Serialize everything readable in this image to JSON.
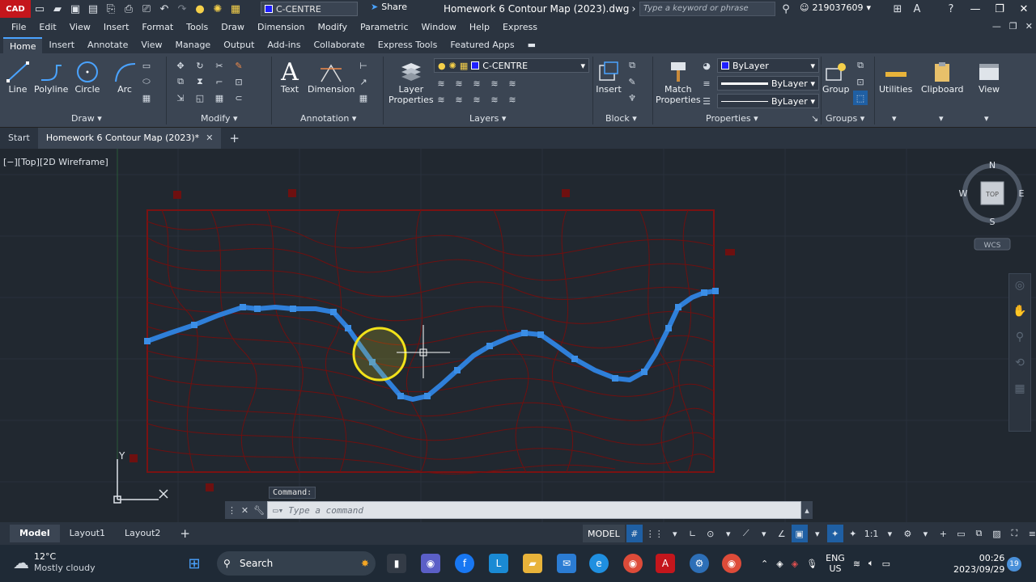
{
  "titlebar": {
    "app_badge": "CAD",
    "layer_current": "C-CENTRE",
    "share_label": "Share",
    "document_title": "Homework 6 Contour Map (2023).dwg",
    "search_placeholder": "Type a keyword or phrase",
    "user_id": "219037609"
  },
  "menu": [
    "File",
    "Edit",
    "View",
    "Insert",
    "Format",
    "Tools",
    "Draw",
    "Dimension",
    "Modify",
    "Parametric",
    "Window",
    "Help",
    "Express"
  ],
  "ribbon_tabs": [
    "Home",
    "Insert",
    "Annotate",
    "View",
    "Manage",
    "Output",
    "Add-ins",
    "Collaborate",
    "Express Tools",
    "Featured Apps"
  ],
  "ribbon": {
    "draw": {
      "line": "Line",
      "polyline": "Polyline",
      "circle": "Circle",
      "arc": "Arc",
      "title": "Draw"
    },
    "modify": {
      "title": "Modify"
    },
    "annotation": {
      "text": "Text",
      "dimension": "Dimension",
      "title": "Annotation"
    },
    "layers": {
      "layer_properties_1": "Layer",
      "layer_properties_2": "Properties",
      "current_layer": "C-CENTRE",
      "title": "Layers"
    },
    "block": {
      "insert": "Insert",
      "title": "Block"
    },
    "properties": {
      "match_1": "Match",
      "match_2": "Properties",
      "color": "ByLayer",
      "linetype": "ByLayer",
      "lineweight": "ByLayer",
      "title": "Properties"
    },
    "groups": {
      "group": "Group",
      "title": "Groups"
    },
    "utilities": "Utilities",
    "clipboard": "Clipboard",
    "view": "View"
  },
  "file_tabs": {
    "start": "Start",
    "active": "Homework 6 Contour Map (2023)*"
  },
  "viewport": {
    "label": "[−][Top][2D Wireframe]",
    "viewcube": {
      "top": "TOP",
      "n": "N",
      "s": "S",
      "e": "E",
      "w": "W",
      "wcs": "WCS"
    },
    "ucs_y": "Y"
  },
  "command": {
    "history": "Command:",
    "placeholder": "Type a command"
  },
  "layout_tabs": [
    "Model",
    "Layout1",
    "Layout2"
  ],
  "status": {
    "model": "MODEL",
    "scale": "1:1"
  },
  "taskbar": {
    "temp": "12°C",
    "weather": "Mostly cloudy",
    "search": "Search",
    "lang_1": "ENG",
    "lang_2": "US",
    "time": "00:26",
    "date": "2023/09/29",
    "notifications": "19"
  },
  "colors": {
    "accent": "#4aa3ff",
    "contour": "#8b1414",
    "polyline": "#2f7fd9",
    "selection_circle": "#f2e21a",
    "layer_blue": "#1e1eff"
  }
}
